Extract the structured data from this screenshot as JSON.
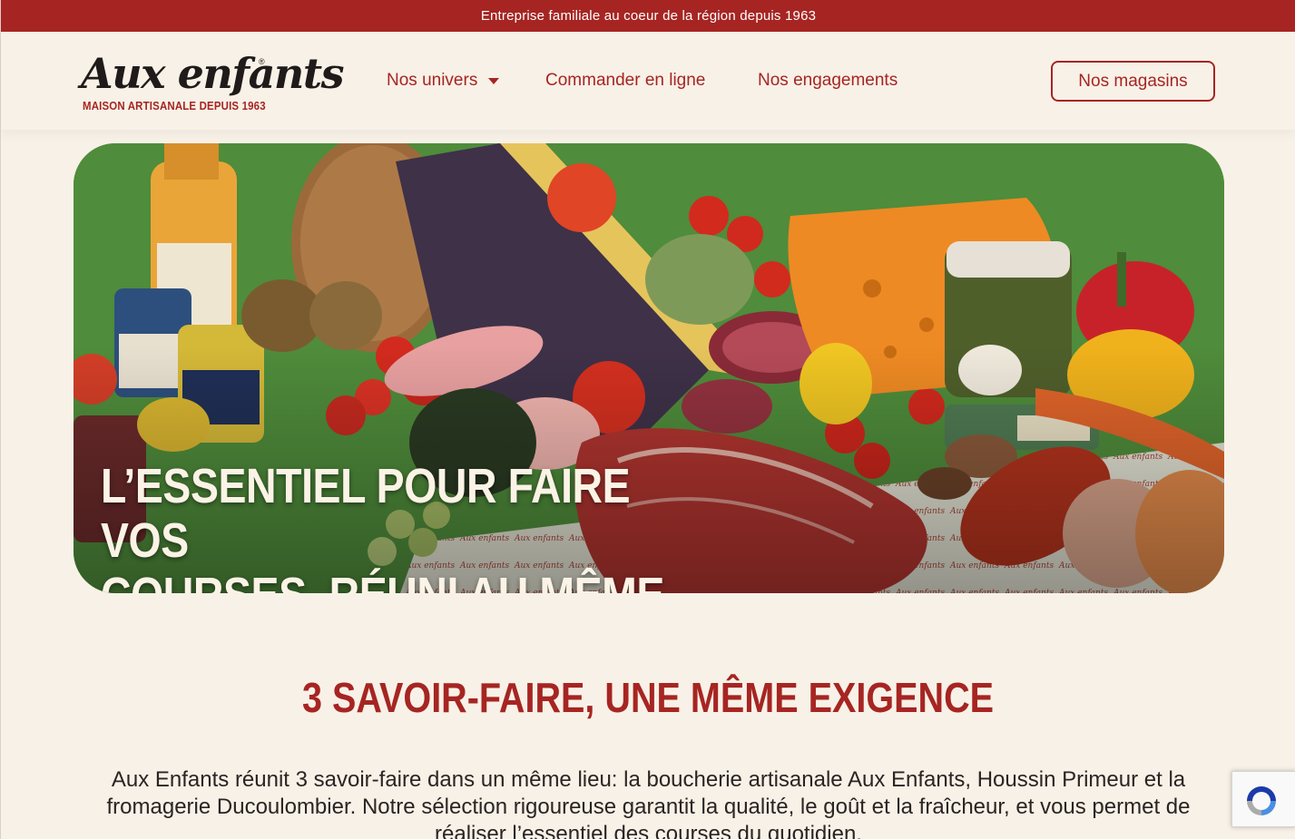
{
  "topbar": {
    "text": "Entreprise familiale au coeur de la région depuis 1963"
  },
  "header": {
    "logo_name": "Aux enfants",
    "logo_registered": "®",
    "logo_tagline": "MAISON ARTISANALE DEPUIS 1963",
    "nav": [
      {
        "label": "Nos univers",
        "has_dropdown": true
      },
      {
        "label": "Commander en ligne"
      },
      {
        "label": "Nos engagements"
      }
    ],
    "cta_label": "Nos magasins"
  },
  "hero": {
    "title": "L’essentiel pour faire vos\ncourses, réuni au même endroit.",
    "image_alt_icon": "grocery-spread-image"
  },
  "section": {
    "title": "3 savoir-faire, une même exigence",
    "body": "Aux Enfants réunit 3 savoir-faire dans un même lieu: la boucherie artisanale Aux Enfants, Houssin Primeur et la fromagerie Ducoulombier. Notre sélection rigoureuse garantit la qualité, le goût et la fraîcheur, et vous permet de réaliser l’essentiel des courses du quotidien."
  },
  "colors": {
    "brand_red": "#a62522",
    "background": "#f8f1e7",
    "hero_green": "#4e8a3a",
    "text_dark": "#2a2423"
  }
}
